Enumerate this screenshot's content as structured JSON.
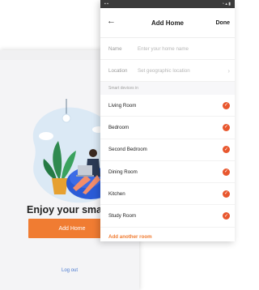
{
  "back_screen": {
    "headline": "Enjoy your smart li",
    "add_home_button": "Add Home",
    "logout_link": "Log out"
  },
  "front_screen": {
    "title": "Add Home",
    "done_label": "Done",
    "fields": [
      {
        "label": "Name",
        "placeholder": "Enter your home name"
      },
      {
        "label": "Location",
        "placeholder": "Set geographic location"
      }
    ],
    "section_label": "Smart devices in",
    "rooms": [
      {
        "name": "Living Room",
        "checked": true
      },
      {
        "name": "Bedroom",
        "checked": true
      },
      {
        "name": "Second Bedroom",
        "checked": true
      },
      {
        "name": "Dining Room",
        "checked": true
      },
      {
        "name": "Kitchen",
        "checked": true
      },
      {
        "name": "Study Room",
        "checked": true
      }
    ],
    "add_room_link": "Add another room"
  },
  "colors": {
    "accent": "#f07c32",
    "check": "#e8572e",
    "link": "#4a7ad0"
  }
}
